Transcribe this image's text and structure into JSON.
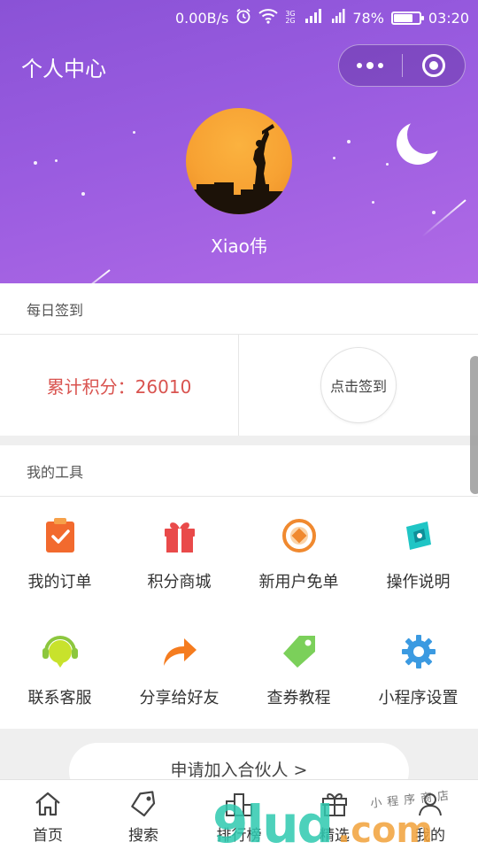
{
  "status_bar": {
    "speed": "0.00B/s",
    "network": "3G 2G",
    "battery_text": "78%",
    "battery_level": 0.78,
    "time": "03:20",
    "icons": [
      "alarm-icon",
      "wifi-icon",
      "signal-icon",
      "battery-icon"
    ]
  },
  "header": {
    "title": "个人中心",
    "username": "Xiao伟",
    "colors": {
      "gradient_start": "#8a52d6",
      "gradient_end": "#b06ae6"
    }
  },
  "daily_signin": {
    "section_title": "每日签到",
    "points_label": "累计积分：26010",
    "sign_button": "点击签到",
    "points_color": "#d9534f"
  },
  "tools": {
    "section_title": "我的工具",
    "items": [
      {
        "label": "我的订单",
        "icon": "clipboard-check-icon"
      },
      {
        "label": "积分商城",
        "icon": "gift-icon"
      },
      {
        "label": "新用户免单",
        "icon": "coin-icon"
      },
      {
        "label": "操作说明",
        "icon": "compass-icon"
      },
      {
        "label": "联系客服",
        "icon": "headset-icon"
      },
      {
        "label": "分享给好友",
        "icon": "share-arrow-icon"
      },
      {
        "label": "查券教程",
        "icon": "tag-icon"
      },
      {
        "label": "小程序设置",
        "icon": "gear-icon"
      }
    ]
  },
  "partner_button": "申请加入合伙人 >",
  "tabbar": [
    {
      "label": "首页",
      "icon": "home-icon"
    },
    {
      "label": "搜索",
      "icon": "tag-search-icon"
    },
    {
      "label": "排行榜",
      "icon": "podium-icon"
    },
    {
      "label": "精选",
      "icon": "gift-box-icon"
    },
    {
      "label": "我的",
      "icon": "user-icon"
    }
  ],
  "watermark": {
    "main": "9lud",
    "suffix": ".com",
    "sub": "小程序商店"
  }
}
